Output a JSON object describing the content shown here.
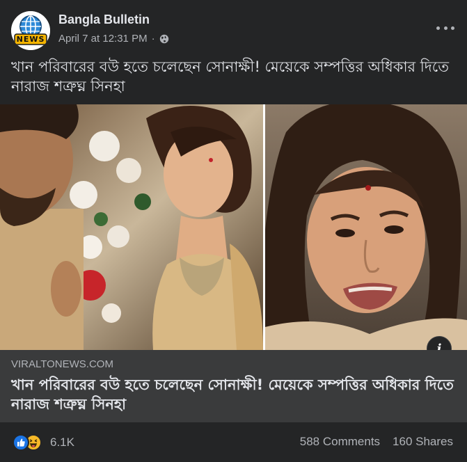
{
  "post": {
    "page_name": "Bangla Bulletin",
    "timestamp": "April 7 at 12:31 PM",
    "separator": "·",
    "avatar_text": "NEWS",
    "caption": "খান পরিবারের বউ হতে চলেছেন সোনাক্ষী! মেয়েকে সম্পত্তির অধিকার দিতে নারাজ শত্রুঘ্ন সিনহা"
  },
  "link": {
    "domain": "VIRALTONEWS.COM",
    "title": "খান পরিবারের বউ হতে চলেছেন সোনাক্ষী! মেয়েকে সম্পত্তির অধিকার দিতে নারাজ শত্রুঘ্ন সিনহা"
  },
  "footer": {
    "reaction_count": "6.1K",
    "comments": "588 Comments",
    "shares": "160 Shares"
  },
  "colors": {
    "background": "#242526",
    "link_box": "#3a3b3c",
    "text_primary": "#e4e6eb",
    "text_secondary": "#b0b3b8",
    "like_blue": "#1b74e4",
    "haha_yellow": "#f7b928"
  },
  "icons": [
    "globe-icon",
    "more-icon",
    "info-icon",
    "like-reaction-icon",
    "haha-reaction-icon"
  ]
}
